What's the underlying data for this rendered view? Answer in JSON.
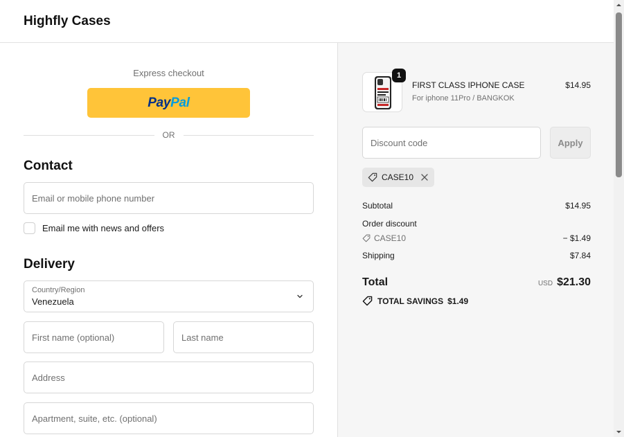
{
  "header": {
    "store_name": "Highfly Cases"
  },
  "express": {
    "label": "Express checkout",
    "paypal_part1": "Pay",
    "paypal_part2": "Pal",
    "or_text": "OR"
  },
  "contact": {
    "title": "Contact",
    "email_placeholder": "Email or mobile phone number",
    "newsletter_label": "Email me with news and offers",
    "newsletter_checked": false
  },
  "delivery": {
    "title": "Delivery",
    "country_label": "Country/Region",
    "country_value": "Venezuela",
    "first_name_placeholder": "First name (optional)",
    "last_name_placeholder": "Last name",
    "address_placeholder": "Address",
    "apartment_placeholder": "Apartment, suite, etc. (optional)"
  },
  "summary": {
    "product": {
      "name": "FIRST CLASS IPHONE CASE",
      "variant": "For iphone 11Pro / BANGKOK",
      "price": "$14.95",
      "quantity": "1"
    },
    "discount_placeholder": "Discount code",
    "apply_label": "Apply",
    "applied_code": "CASE10",
    "subtotal_label": "Subtotal",
    "subtotal_value": "$14.95",
    "order_discount_label": "Order discount",
    "order_discount_code": "CASE10",
    "order_discount_value": "− $1.49",
    "shipping_label": "Shipping",
    "shipping_value": "$7.84",
    "total_label": "Total",
    "currency": "USD",
    "total_value": "$21.30",
    "savings_label": "TOTAL SAVINGS",
    "savings_value": "$1.49"
  },
  "colors": {
    "paypal_yellow": "#ffc439",
    "paypal_dark_blue": "#003087",
    "paypal_light_blue": "#009cde",
    "summary_bg": "#f6f6f6"
  }
}
